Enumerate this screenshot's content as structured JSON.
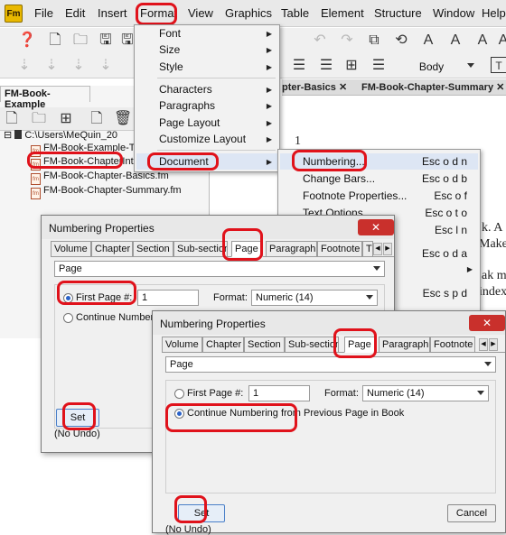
{
  "menubar": {
    "logo": "Fm",
    "items": [
      "File",
      "Edit",
      "Insert",
      "Format",
      "View",
      "Graphics",
      "Table",
      "Element",
      "Structure",
      "Window",
      "Help"
    ]
  },
  "toolbar": {
    "style_select": "Body"
  },
  "doc_tabs": [
    "pter-Basics",
    "FM-Book-Chapter-Summary"
  ],
  "doc_text": [
    "1",
    "k. A",
    "Make",
    "ak m",
    "index"
  ],
  "panel": {
    "title": "FM-Book-Example",
    "book_path": "C:\\Users\\MeQuin_20",
    "files": [
      "FM-Book-Example-T",
      "FM-Book-ChapterInt",
      "FM-Book-Chapter-Basics.fm",
      "FM-Book-Chapter-Summary.fm"
    ]
  },
  "format_menu": {
    "items": [
      "Font",
      "Size",
      "Style",
      "Characters",
      "Paragraphs",
      "Page Layout",
      "Customize Layout",
      "Document"
    ]
  },
  "document_submenu": {
    "items": [
      {
        "label": "Numbering...",
        "shortcut": "Esc o d n"
      },
      {
        "label": "Change Bars...",
        "shortcut": "Esc o d b"
      },
      {
        "label": "Footnote Properties...",
        "shortcut": "Esc o f"
      },
      {
        "label": "Text Options...",
        "shortcut": "Esc o t o"
      },
      {
        "label": "",
        "shortcut": "Esc l n"
      },
      {
        "label": "",
        "shortcut": "Esc o d a"
      },
      {
        "label": "",
        "shortcut": "Esc s p d"
      }
    ]
  },
  "dialog1": {
    "title": "Numbering Properties",
    "close": "✕",
    "tabs": [
      "Volume",
      "Chapter",
      "Section",
      "Sub-section",
      "Page",
      "Paragraph",
      "Footnote",
      "T"
    ],
    "select": "Page",
    "first_page_label": "First Page #:",
    "first_page_value": "1",
    "format_label": "Format:",
    "format_value": "Numeric (14)",
    "continue_label": "Continue Numberi",
    "set_button": "Set",
    "undo_label": "(No Undo)"
  },
  "dialog2": {
    "title": "Numbering Properties",
    "close": "✕",
    "tabs": [
      "Volume",
      "Chapter",
      "Section",
      "Sub-section",
      "Page",
      "Paragraph",
      "Footnote"
    ],
    "select": "Page",
    "first_page_label": "First Page #:",
    "first_page_value": "1",
    "format_label": "Format:",
    "format_value": "Numeric (14)",
    "continue_label": "Continue Numbering from Previous Page in Book",
    "set_button": "Set",
    "cancel_button": "Cancel",
    "undo_label": "(No Undo)"
  },
  "colors": {
    "highlight": "#e0121b",
    "selection": "#2a62c9"
  }
}
